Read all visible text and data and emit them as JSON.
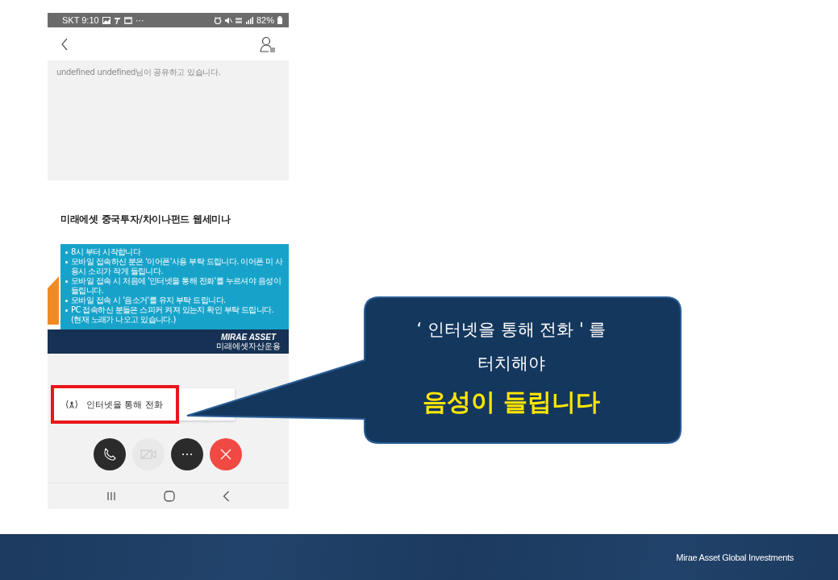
{
  "phone": {
    "status_bar": {
      "carrier_time": "SKT 9:10",
      "more": "···",
      "battery": "82%"
    },
    "notice": "undefined undefined님이 공유하고 있습니다.",
    "shared_slide": {
      "title": "미래에셋 중국투자/차이나펀드 웹세미나",
      "bullets": [
        "8시 부터 시작합니다",
        "모바일 접속하신 분은 '이어폰'사용 부탁 드립니다. 이어폰 미 사용시 소리가 작게 들립니다.",
        "모바일 접속 시 처음에 '인터넷을 통해 전화'를 누르셔야 음성이 들립니다.",
        "모바일 접속 시 '음소거'를 유지 부탁 드립니다.",
        "PC 접속하신 분들은 스피커 켜져 있는지 확인 부탁 드립니다. (현재 노래가 나오고 있습니다.)"
      ],
      "logo": "MIRAE ASSET",
      "logo_sub": "미래에셋자산운용"
    },
    "popup_menu": [
      {
        "label": "인터넷을 통해 전화",
        "highlighted": true
      }
    ],
    "call_buttons": [
      {
        "kind": "phone",
        "disabled": false
      },
      {
        "kind": "video",
        "disabled": true
      },
      {
        "kind": "more",
        "disabled": false
      },
      {
        "kind": "hangup",
        "disabled": false
      }
    ]
  },
  "callout": {
    "lines": [
      "‘ 인터넷을 통해 전화 ' 를",
      "터치해야"
    ],
    "emphasis": "음성이 들립니다"
  },
  "footer": {
    "brand": "Mirae Asset Global Investments"
  }
}
